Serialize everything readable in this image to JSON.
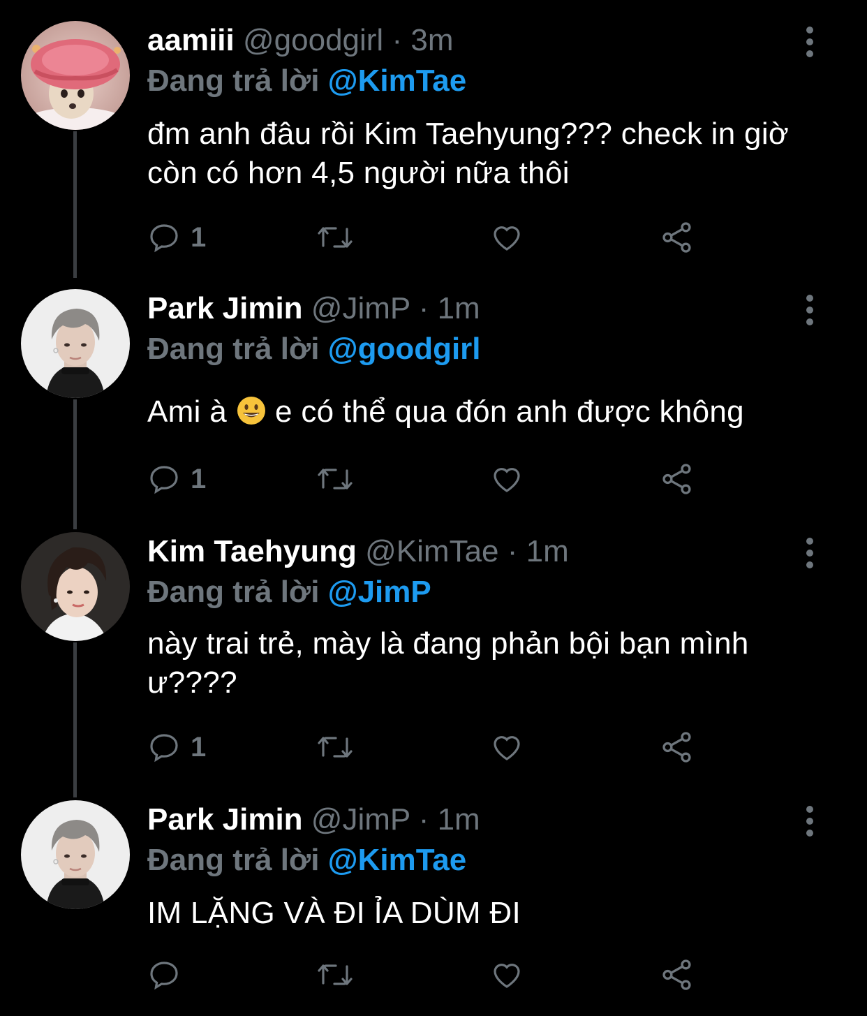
{
  "theme": {
    "background": "#000000",
    "primary_text": "#ffffff",
    "secondary_text": "#6e767d",
    "link": "#1d9bf0",
    "thread_line": "#3a3d41"
  },
  "tweets": [
    {
      "display_name": "aamiii",
      "handle": "@goodgirl",
      "separator": "·",
      "time": "3m",
      "reply_prefix": "Đang trả lời",
      "reply_to": "@KimTae",
      "text": "đm anh đâu rồi Kim Taehyung??? check in giờ còn có hơn 4,5 người nữa thôi",
      "reply_count": "1",
      "avatar_icon": "chihuahua-shower-cap-avatar"
    },
    {
      "display_name": "Park Jimin",
      "handle": "@JimP",
      "separator": "·",
      "time": "1m",
      "reply_prefix": "Đang trả lời",
      "reply_to": "@goodgirl",
      "text_before_emoji": "Ami à",
      "emoji": "grinning-face-emoji",
      "text_after_emoji": "e có thể qua đón anh được không",
      "reply_count": "1",
      "avatar_icon": "park-jimin-avatar"
    },
    {
      "display_name": "Kim Taehyung",
      "handle": "@KimTae",
      "separator": "·",
      "time": "1m",
      "reply_prefix": "Đang trả lời",
      "reply_to": "@JimP",
      "text": "này trai trẻ, mày là đang phản bội bạn mình ư????",
      "reply_count": "1",
      "avatar_icon": "kim-taehyung-avatar"
    },
    {
      "display_name": "Park Jimin",
      "handle": "@JimP",
      "separator": "·",
      "time": "1m",
      "reply_prefix": "Đang trả lời",
      "reply_to": "@KimTae",
      "text": "IM LẶNG VÀ ĐI ỈA DÙM ĐI",
      "reply_count": "",
      "avatar_icon": "park-jimin-avatar"
    }
  ]
}
